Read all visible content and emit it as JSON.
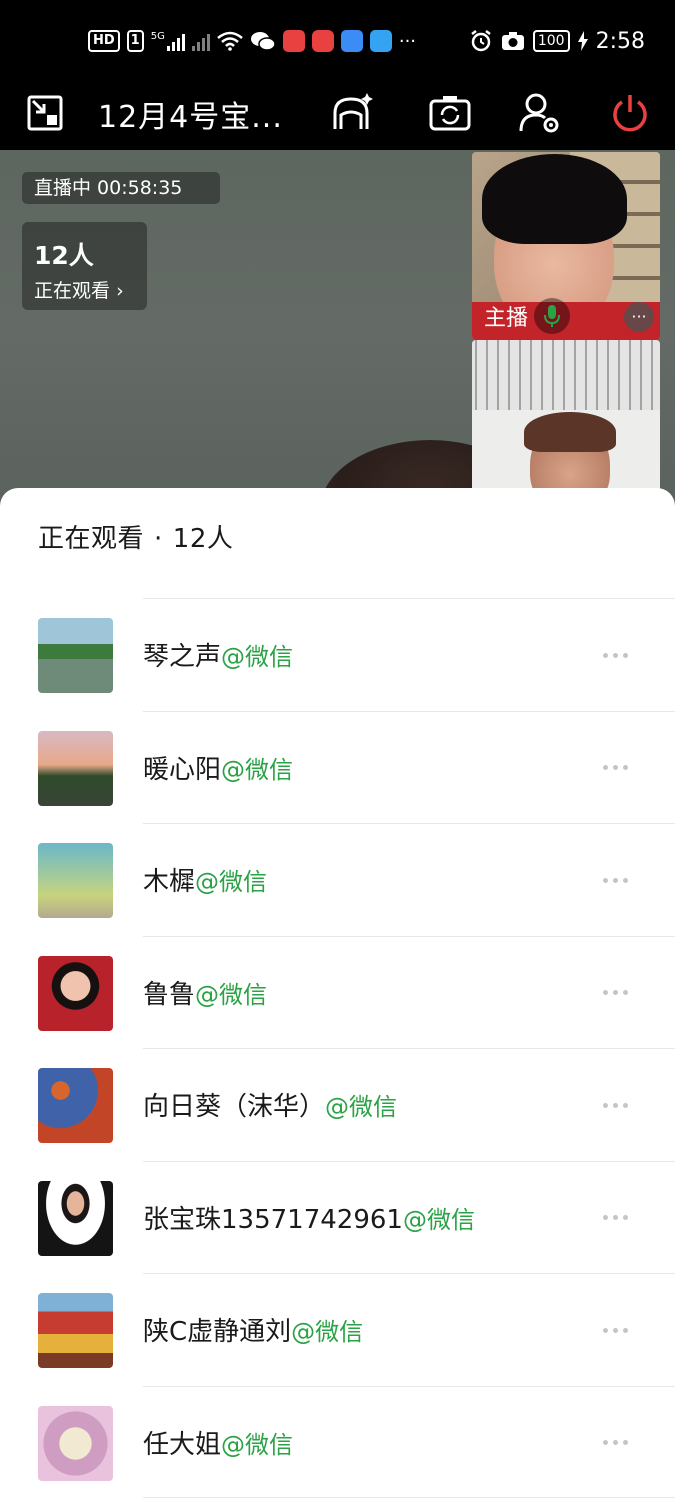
{
  "status_bar": {
    "hd_label": "HD",
    "sim_label": "1",
    "network_label": "5G",
    "battery": "100",
    "time": "2:58",
    "more": "···",
    "colors": {
      "app_red": "#e9413f",
      "app_heart": "#e9413f",
      "app_cloud": "#3b8df5",
      "app_search": "#33a3f2"
    }
  },
  "toolbar": {
    "title": "12月4号宝...",
    "icons": [
      "minimize-window-icon",
      "beauty-filter-icon",
      "flip-camera-icon",
      "member-settings-icon",
      "power-icon"
    ],
    "power_color": "#e9413f"
  },
  "video": {
    "live_label": "直播中 00:58:35",
    "viewer_count": "12人",
    "viewer_watching": "正在观看",
    "host_label": "主播",
    "mic_color": "#2ba245"
  },
  "sheet": {
    "title": "正在观看",
    "separator": "·",
    "count": "12人",
    "source_color": "#2ba245",
    "viewers": [
      {
        "name": "琴之声",
        "source": "@微信"
      },
      {
        "name": "暖心阳",
        "source": "@微信"
      },
      {
        "name": "木樨",
        "source": "@微信"
      },
      {
        "name": "鲁鲁",
        "source": "@微信"
      },
      {
        "name": "向日葵（沫华）",
        "source": "@微信"
      },
      {
        "name": "张宝珠13571742961",
        "source": "@微信"
      },
      {
        "name": "陕C虚静通刘",
        "source": "@微信"
      },
      {
        "name": "任大姐",
        "source": "@微信"
      }
    ]
  }
}
